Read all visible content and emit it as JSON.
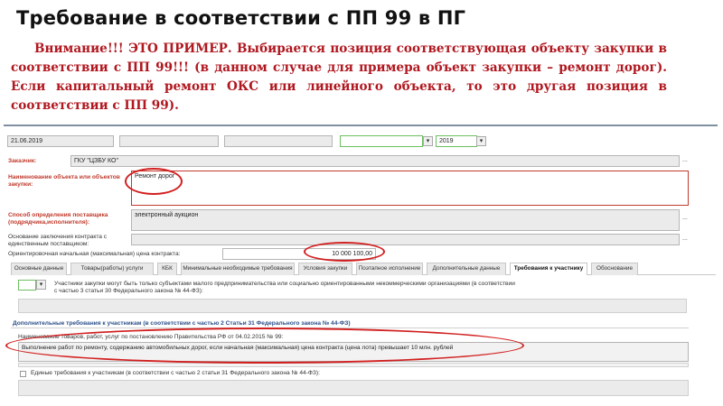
{
  "slide": {
    "title": "Требование в соответствии с ПП 99 в ПГ",
    "note": "Внимание!!! ЭТО ПРИМЕР. Выбирается позиция соответствующая объекту закупки в соответствии с ПП 99!!! (в данном случае для примера объект закупки – ремонт дорог). Если капитальный ремонт ОКС или линейного  объекта, то это другая позиция в соответствии с ПП 99)."
  },
  "form": {
    "date": "21.06.2019",
    "year": "2019",
    "customer_label": "Заказчик:",
    "customer_value": "ГКУ \"ЦЗБУ КО\"",
    "object_label": "Наименование объекта или объектов закупки:",
    "object_value": "Ремонт дорог",
    "method_label": "Способ определения поставщика (подрядчика,исполнителя):",
    "method_value": "электронный аукцион",
    "basis_label": "Основание заключения контракта с единственным поставщиком:",
    "price_label": "Ориентировочная начальная (максимальная) цена контракта:",
    "price_value": "10 000 100,00",
    "ellipsis": "..."
  },
  "tabs": [
    "Основные данные",
    "Товары(работы) услуги",
    "КБК",
    "Минимальные необходимые требования",
    "Условия закупки",
    "Поэтапное исполнение",
    "Дополнительные данные",
    "Требования к участнику",
    "Обоснование"
  ],
  "requirements": {
    "smb_text": "Участники закупки могут быть только субъектами малого предпринимательства или социально ориентированными некоммерческими организациями (в соответствии с частью 3 статьи 30 Федерального закона № 44-ФЗ):",
    "additional_title": "Дополнительные требования к участникам (в соответствии с частью 2 Статьи 31 Федерального закона № 44-ФЗ)",
    "pp99_label": "Наименование товаров, работ, услуг по постановлению Правительства РФ от 04.02.2015 № 99:",
    "pp99_value": "Выполнение работ по ремонту, содержанию автомобильных дорог, если начальная (максимальная) цена контракта (цена лота) превышает 10 млн. рублей",
    "unified_label": "Единые требования к участникам (в соответствии с частью 2 статьи 31 Федерального закона № 44-ФЗ):"
  },
  "colors": {
    "note_text": "#b0171f",
    "annotation_ellipse": "#d21f1f",
    "label_red": "#c0392b",
    "section_blue": "#2b4f8a",
    "field_green_border": "#6bbf5e"
  }
}
